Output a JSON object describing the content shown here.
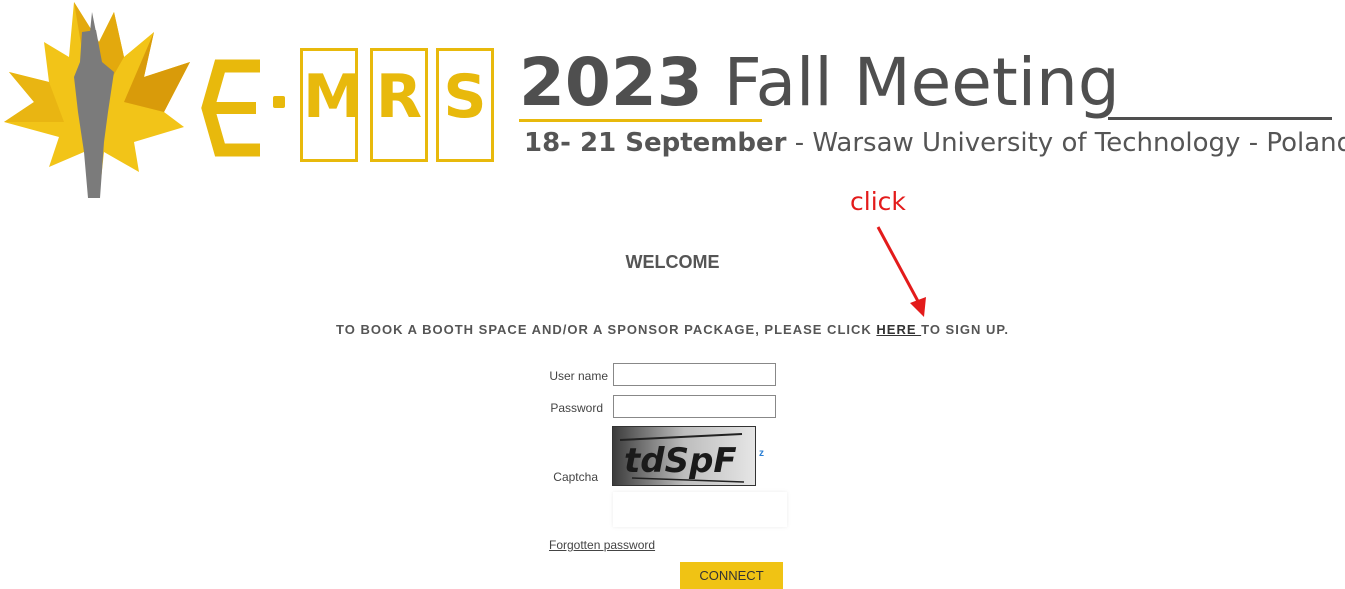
{
  "header": {
    "logo_letters": [
      "M",
      "R",
      "S"
    ],
    "title_year": "2023",
    "title_rest": "Fall Meeting",
    "subtitle_dates": "18- 21 September",
    "subtitle_rest": " - Warsaw University of Technology - Poland",
    "brand_color": "#e8b90c",
    "text_color": "#4f4f4f"
  },
  "annotation": {
    "label": "click",
    "color": "#e31b1b"
  },
  "main": {
    "welcome": "WELCOME",
    "booking_prefix": "TO BOOK A BOOTH SPACE AND/OR A SPONSOR PACKAGE, PLEASE CLICK ",
    "booking_link": "HERE ",
    "booking_suffix": "TO SIGN UP."
  },
  "form": {
    "username_label": "User name",
    "username_value": "",
    "password_label": "Password",
    "password_value": "",
    "captcha_label": "Captcha",
    "captcha_text": "tdSpF",
    "captcha_refresh_icon": "refresh-icon",
    "captcha_value": "",
    "forgot_label": "Forgotten password",
    "connect_label": "CONNECT",
    "connect_color": "#f0c314"
  }
}
